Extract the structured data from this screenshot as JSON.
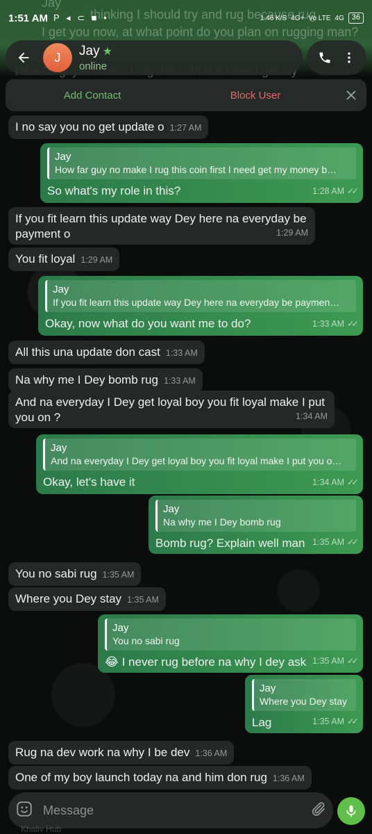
{
  "status_bar": {
    "time": "1:51 AM",
    "left_icons": "P ◂ ⊂ ■ •",
    "speed": "1.46 K/S",
    "network": "4G+",
    "volte": "Vo LTE",
    "network2": "4G",
    "battery": "36"
  },
  "ghost": {
    "line1": "Jay",
    "line2": "thinking I should try and rug because rug",
    "line3": "I get you now, at what point do you plan on rugging man?",
    "line4": "How far guy no make I rug this coin first I need get my"
  },
  "header": {
    "avatar_letter": "J",
    "name": "Jay",
    "status": "online"
  },
  "action_bar": {
    "add_contact": "Add Contact",
    "block_user": "Block User"
  },
  "messages": [
    {
      "text": "I no say you no get update o",
      "time": "1:27 AM"
    },
    {
      "reply_name": "Jay",
      "reply_text": "How far guy no make I rug this coin first I need get my money b…",
      "text": "So what's my role in this?",
      "time": "1:28 AM"
    },
    {
      "text": "If you fit learn this update way Dey here na everyday be payment o",
      "time": "1:29 AM"
    },
    {
      "text": "You fit loyal",
      "time": "1:29 AM"
    },
    {
      "reply_name": "Jay",
      "reply_text": "If you fit learn this update way Dey here na everyday be paymen…",
      "text": "Okay, now what do you want me to do?",
      "time": "1:33 AM"
    },
    {
      "text": "All this una update don cast",
      "time": "1:33 AM"
    },
    {
      "text": "Na why me I Dey bomb rug",
      "time": "1:33 AM"
    },
    {
      "text": "And na everyday I Dey get loyal boy you fit loyal make I put you on ?",
      "time": "1:34 AM"
    },
    {
      "reply_name": "Jay",
      "reply_text": "And na everyday I Dey get loyal boy you fit loyal make I put you o…",
      "text": "Okay, let's have it",
      "time": "1:34 AM"
    },
    {
      "reply_name": "Jay",
      "reply_text": "Na why me I Dey bomb rug",
      "text": "Bomb rug? Explain well man",
      "time": "1:35 AM"
    },
    {
      "text": "You no sabi rug",
      "time": "1:35 AM"
    },
    {
      "text": "Where you Dey stay",
      "time": "1:35 AM"
    },
    {
      "reply_name": "Jay",
      "reply_text": "You no sabi rug",
      "emoji": "😂",
      "text": "I never rug before na why I dey ask",
      "time": "1:35 AM"
    },
    {
      "reply_name": "Jay",
      "reply_text": "Where you Dey stay",
      "text": "Lag",
      "time": "1:35 AM"
    },
    {
      "text": "Rug na dev work na why I be dev",
      "time": "1:36 AM"
    },
    {
      "text": "One of my boy launch today na and him don rug",
      "time": "1:36 AM"
    }
  ],
  "input": {
    "placeholder": "Message"
  },
  "bottom_ghost": "Khaliv Hub",
  "colors": {
    "incoming_bubble": "#262727",
    "outgoing_bubble": "#3d9a52",
    "accent_green": "#6cc06c",
    "block_red": "#e46a6a",
    "mic_button": "#5fbf4a"
  }
}
